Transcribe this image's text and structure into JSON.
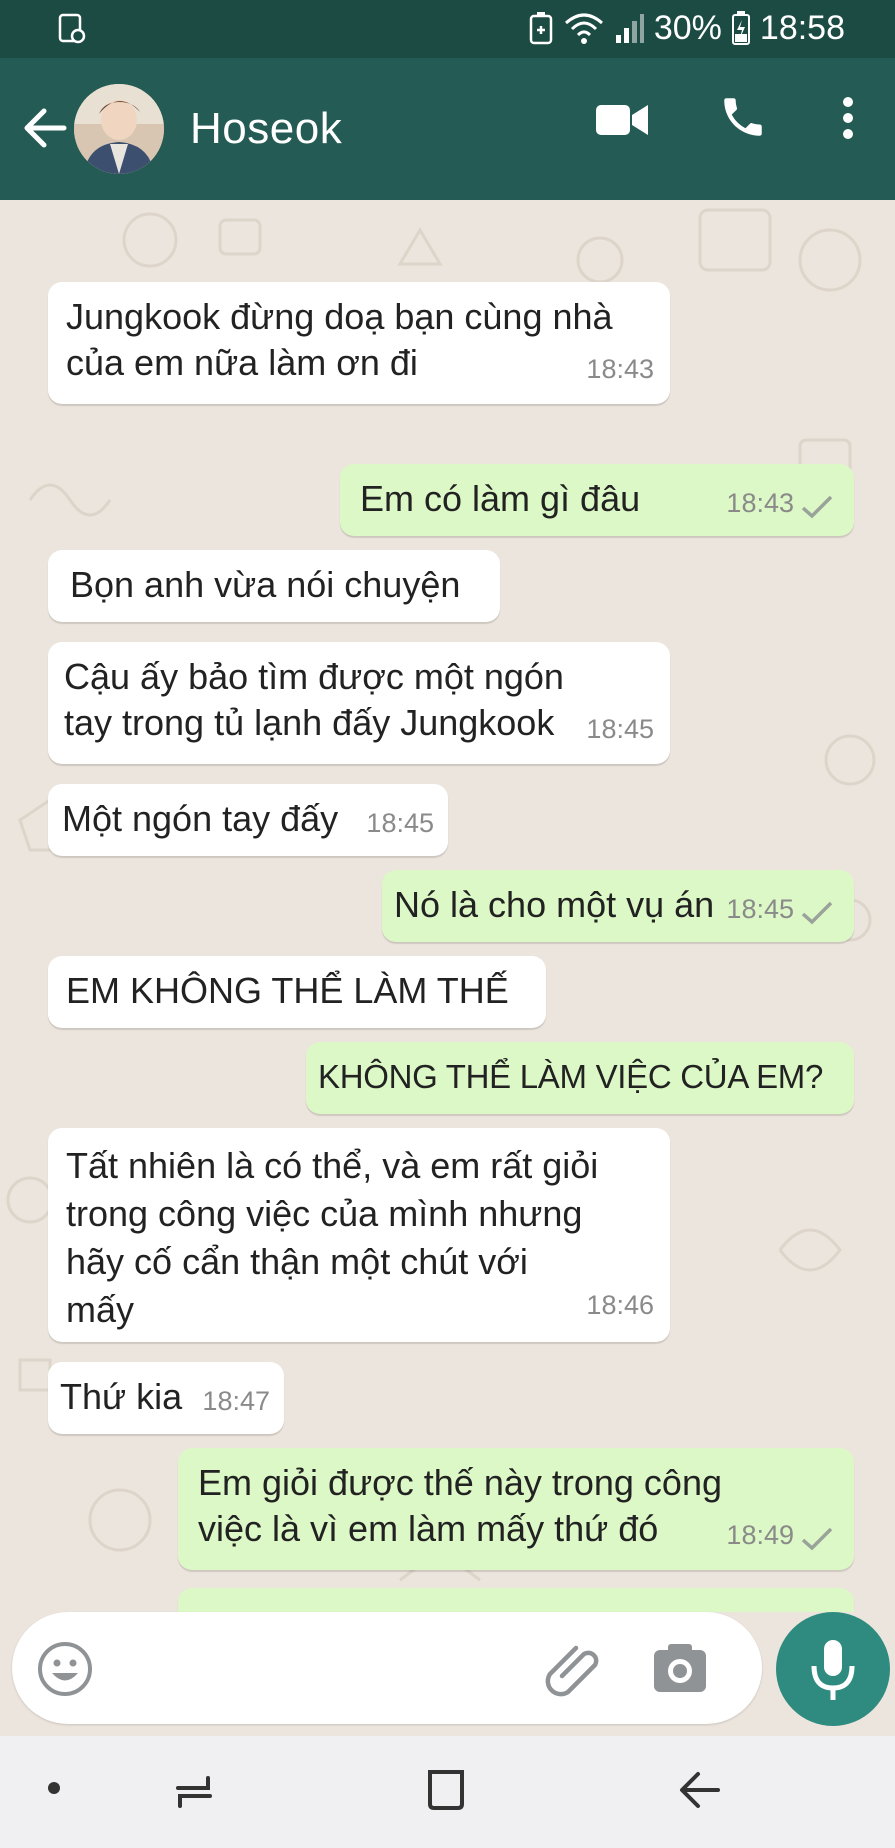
{
  "status_bar": {
    "battery_percent": "30%",
    "time": "18:58"
  },
  "app_bar": {
    "contact_name": "Hoseok"
  },
  "messages": [
    {
      "direction": "in",
      "lines": [
        "Jungkook đừng doạ bạn cùng nhà",
        "của em nữa làm ơn đi"
      ],
      "time": "18:43"
    },
    {
      "direction": "out",
      "lines": [
        "Em có làm gì đâu"
      ],
      "time": "18:43"
    },
    {
      "direction": "in",
      "lines": [
        "Bọn anh vừa nói chuyện"
      ],
      "time": ""
    },
    {
      "direction": "in",
      "lines": [
        "Cậu ấy bảo tìm được một ngón",
        "tay trong tủ lạnh đấy Jungkook"
      ],
      "time": "18:45"
    },
    {
      "direction": "in",
      "lines": [
        "Một ngón tay đấy"
      ],
      "time": "18:45"
    },
    {
      "direction": "out",
      "lines": [
        "Nó là cho một vụ án"
      ],
      "time": "18:45"
    },
    {
      "direction": "in",
      "lines": [
        "EM KHÔNG THỂ LÀM THẾ"
      ],
      "time": ""
    },
    {
      "direction": "out",
      "lines": [
        "KHÔNG THỂ LÀM VIỆC CỦA EM?"
      ],
      "time": ""
    },
    {
      "direction": "in",
      "lines": [
        "Tất nhiên là có thể, và em rất giỏi",
        "trong công việc của mình nhưng",
        "hãy cố cẩn thận một chút với",
        "mấy"
      ],
      "time": "18:46"
    },
    {
      "direction": "in",
      "lines": [
        "Thứ kia"
      ],
      "time": "18:47"
    },
    {
      "direction": "out",
      "lines": [
        "Em giỏi được thế này trong công",
        "việc là vì em làm mấy thứ đó"
      ],
      "time": "18:49"
    }
  ],
  "icons": {
    "back": "arrow-left-icon",
    "video": "video-camera-icon",
    "call": "phone-icon",
    "menu": "more-vert-icon",
    "emoji": "emoji-icon",
    "attach": "paperclip-icon",
    "camera": "camera-icon",
    "mic": "microphone-icon"
  },
  "colors": {
    "app_bar": "#245c55",
    "outgoing_bubble": "#dcf8c6",
    "incoming_bubble": "#ffffff",
    "chat_background": "#ece5dd",
    "mic_button": "#2f8b7f"
  }
}
